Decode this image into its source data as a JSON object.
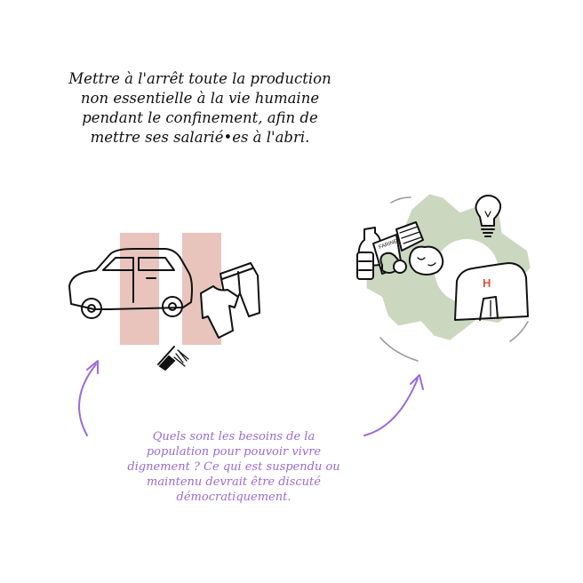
{
  "top_text": {
    "lines": [
      "Mettre à l'arrêt toute la production",
      "non essentielle à la vie humaine",
      "pendant le confinement, afin de",
      "mettre ses salarié•es à l'abri."
    ]
  },
  "bottom_text": {
    "lines": [
      "Quels sont les besoins de la",
      "population pour pouvoir vivre",
      "dignement ? Ce qui est suspendu ou",
      "maintenu devrait être discuté",
      "démocratiquement."
    ]
  },
  "labels": {
    "flour_bag": "FARINE",
    "hospital_letter": "H"
  },
  "colors": {
    "ink": "#111111",
    "stripe": "#e9c4bc",
    "gear": "#ccd7c0",
    "purple": "#9b6bd6",
    "hospital_h": "#d9553c"
  }
}
